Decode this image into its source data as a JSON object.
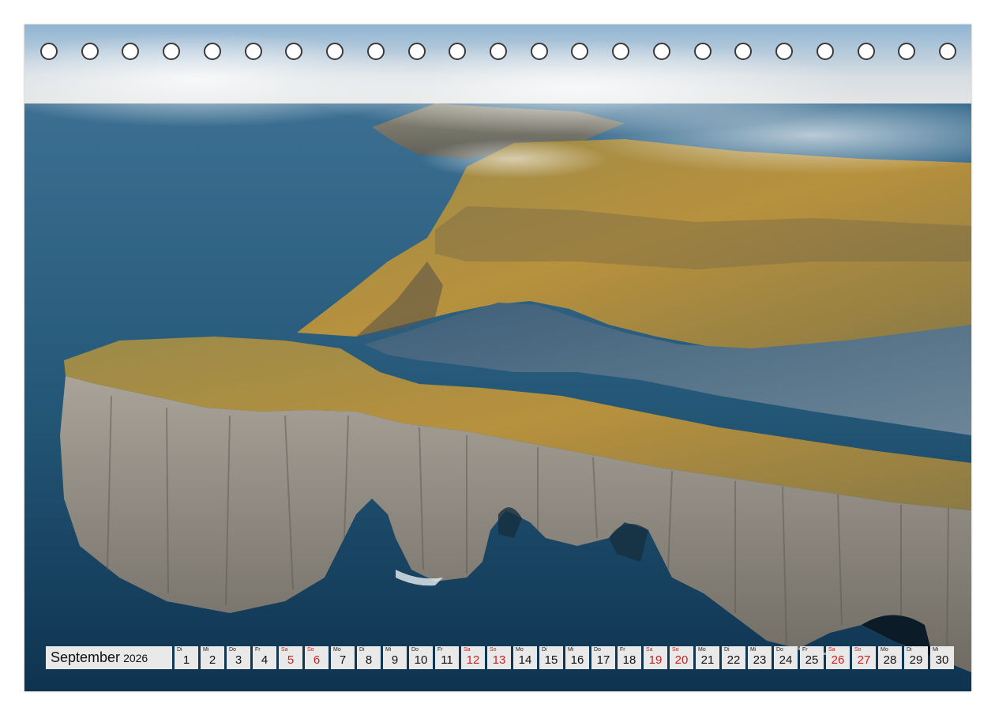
{
  "calendar": {
    "month": "September",
    "year": "2026",
    "days": [
      {
        "wd": "Di",
        "d": "1",
        "weekend": false
      },
      {
        "wd": "Mi",
        "d": "2",
        "weekend": false
      },
      {
        "wd": "Do",
        "d": "3",
        "weekend": false
      },
      {
        "wd": "Fr",
        "d": "4",
        "weekend": false
      },
      {
        "wd": "Sa",
        "d": "5",
        "weekend": true
      },
      {
        "wd": "So",
        "d": "6",
        "weekend": true
      },
      {
        "wd": "Mo",
        "d": "7",
        "weekend": false
      },
      {
        "wd": "Di",
        "d": "8",
        "weekend": false
      },
      {
        "wd": "Mi",
        "d": "9",
        "weekend": false
      },
      {
        "wd": "Do",
        "d": "10",
        "weekend": false
      },
      {
        "wd": "Fr",
        "d": "11",
        "weekend": false
      },
      {
        "wd": "Sa",
        "d": "12",
        "weekend": true
      },
      {
        "wd": "So",
        "d": "13",
        "weekend": true
      },
      {
        "wd": "Mo",
        "d": "14",
        "weekend": false
      },
      {
        "wd": "Di",
        "d": "15",
        "weekend": false
      },
      {
        "wd": "Mi",
        "d": "16",
        "weekend": false
      },
      {
        "wd": "Do",
        "d": "17",
        "weekend": false
      },
      {
        "wd": "Fr",
        "d": "18",
        "weekend": false
      },
      {
        "wd": "Sa",
        "d": "19",
        "weekend": true
      },
      {
        "wd": "So",
        "d": "20",
        "weekend": true
      },
      {
        "wd": "Mo",
        "d": "21",
        "weekend": false
      },
      {
        "wd": "Di",
        "d": "22",
        "weekend": false
      },
      {
        "wd": "Mi",
        "d": "23",
        "weekend": false
      },
      {
        "wd": "Do",
        "d": "24",
        "weekend": false
      },
      {
        "wd": "Fr",
        "d": "25",
        "weekend": false
      },
      {
        "wd": "Sa",
        "d": "26",
        "weekend": true
      },
      {
        "wd": "So",
        "d": "27",
        "weekend": true
      },
      {
        "wd": "Mo",
        "d": "28",
        "weekend": false
      },
      {
        "wd": "Di",
        "d": "29",
        "weekend": false
      },
      {
        "wd": "Mi",
        "d": "30",
        "weekend": false
      }
    ]
  },
  "colors": {
    "weekend_text": "#cc1f1f",
    "cell_bg": "#e9e9e9",
    "sea": "#1d4f73",
    "cliff_grass": "#b08a3a",
    "cliff_rock": "#8f8a80"
  }
}
